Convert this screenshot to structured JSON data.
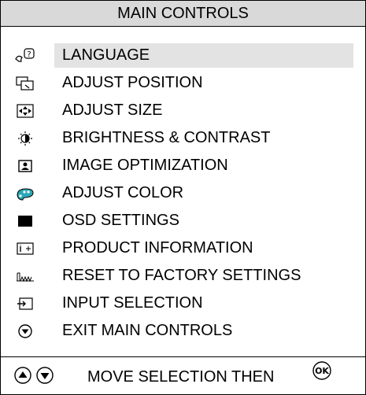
{
  "header": {
    "title": "MAIN CONTROLS"
  },
  "menu": {
    "items": [
      {
        "label": "LANGUAGE",
        "icon": "language-icon",
        "selected": true
      },
      {
        "label": "ADJUST POSITION",
        "icon": "adjust-position-icon"
      },
      {
        "label": "ADJUST SIZE",
        "icon": "adjust-size-icon"
      },
      {
        "label": "BRIGHTNESS & CONTRAST",
        "icon": "brightness-icon"
      },
      {
        "label": "IMAGE OPTIMIZATION",
        "icon": "image-optimization-icon"
      },
      {
        "label": "ADJUST COLOR",
        "icon": "adjust-color-icon"
      },
      {
        "label": "OSD SETTINGS",
        "icon": "osd-settings-icon"
      },
      {
        "label": "PRODUCT INFORMATION",
        "icon": "product-information-icon"
      },
      {
        "label": "RESET TO FACTORY SETTINGS",
        "icon": "reset-factory-icon"
      },
      {
        "label": "INPUT SELECTION",
        "icon": "input-selection-icon"
      },
      {
        "label": "EXIT MAIN CONTROLS",
        "icon": "exit-icon"
      }
    ]
  },
  "footer": {
    "instruction": "MOVE SELECTION THEN",
    "ok_label": "OK",
    "icons": [
      "up-arrow-icon",
      "down-arrow-icon",
      "ok-button-icon"
    ]
  },
  "colors": {
    "header_bg": "#d9d9d9",
    "selected_bg": "#e3e3e3",
    "color_icon": "#2aa7b5"
  }
}
